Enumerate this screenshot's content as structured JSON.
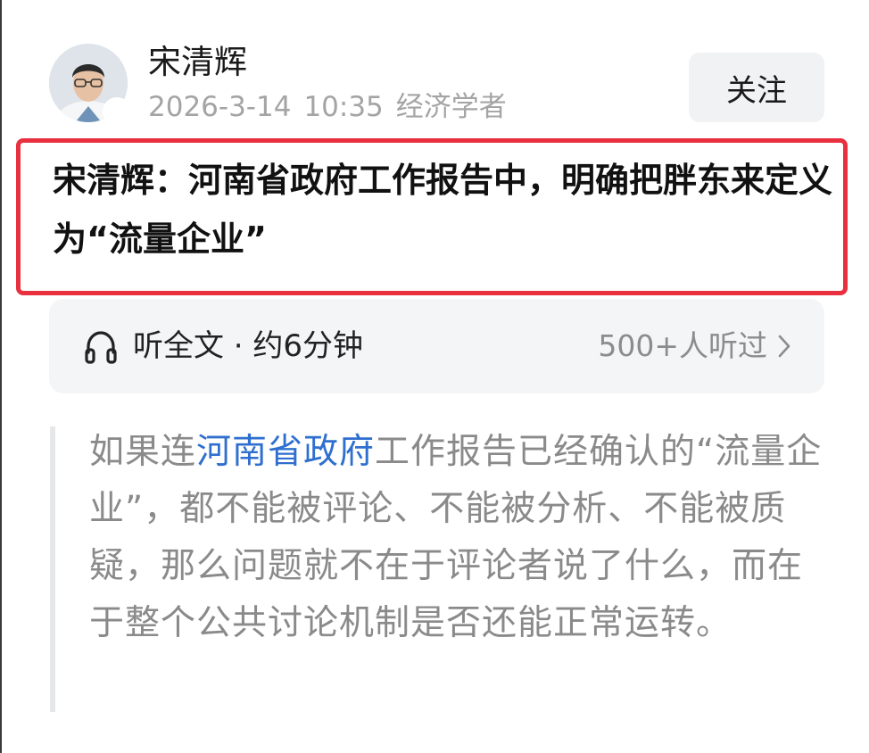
{
  "author": {
    "name": "宋清辉",
    "date": "2026-3-14",
    "time": "10:35",
    "title": "经济学者",
    "avatar_icon": "person-portrait"
  },
  "follow": {
    "label": "关注"
  },
  "article": {
    "headline": "宋清辉：河南省政府工作报告中，明确把胖东来定义为“流量企业”"
  },
  "listen": {
    "icon": "headphones-icon",
    "label": "听全文 · 约6分钟",
    "count": "500+人听过"
  },
  "quote": {
    "text_before": "如果连",
    "link_text": "河南省政府",
    "text_after": "工作报告已经确认的“流量企业”，都不能被评论、不能被分析、不能被质疑，那么问题就不在于评论者说了什么，而在于整个公共讨论机制是否还能正常运转。"
  },
  "colors": {
    "highlight_border": "#e8303f",
    "link": "#2f6fcf"
  }
}
